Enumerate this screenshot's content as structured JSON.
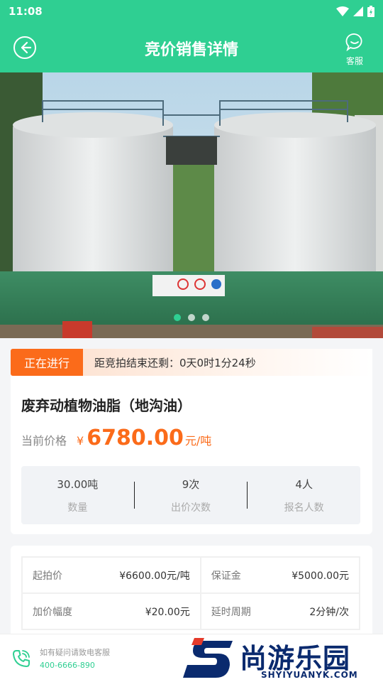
{
  "status_bar": {
    "time": "11:08"
  },
  "header": {
    "title": "竞价销售详情",
    "service_label": "客服"
  },
  "banner": {
    "image_count": 3,
    "active_index": 0
  },
  "auction": {
    "status_tag": "正在进行",
    "countdown_text": "距竞拍结束还剩：0天0时1分24秒",
    "product_name": "废弃动植物油脂（地沟油）",
    "price_label": "当前价格",
    "price_currency": "¥",
    "price_value": "6780.00",
    "price_unit": "元/吨"
  },
  "stats": [
    {
      "value": "30.00吨",
      "label": "数量"
    },
    {
      "value": "9次",
      "label": "出价次数"
    },
    {
      "value": "4人",
      "label": "报名人数"
    }
  ],
  "details": {
    "rows": [
      [
        {
          "label": "起拍价",
          "value": "¥6600.00元/吨"
        },
        {
          "label": "保证金",
          "value": "¥5000.00元"
        }
      ],
      [
        {
          "label": "加价幅度",
          "value": "¥20.00元"
        },
        {
          "label": "延时周期",
          "value": "2分钟/次"
        }
      ]
    ]
  },
  "footer": {
    "help_text": "如有疑问请致电客服",
    "phone": "400-6666-890"
  },
  "watermark": {
    "main": "尚游乐园",
    "sub": "SHYIYUANYK.COM"
  },
  "colors": {
    "primary": "#2fcf92",
    "accent": "#fb6b1a"
  }
}
